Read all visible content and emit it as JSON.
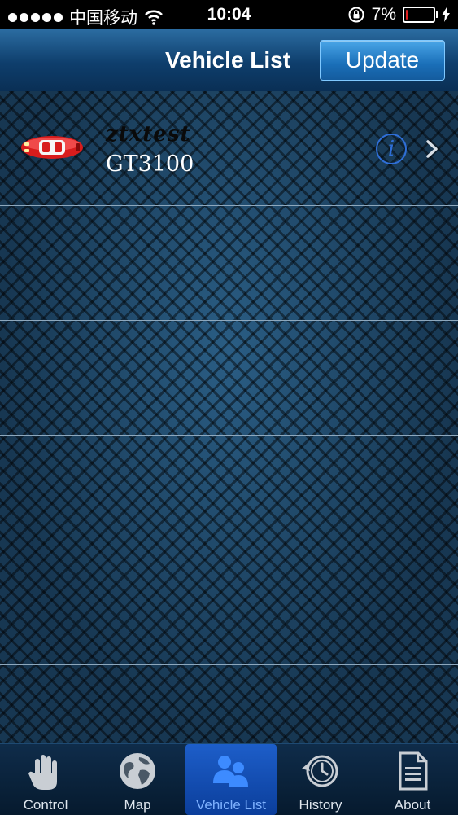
{
  "status_bar": {
    "carrier": "中国移动",
    "time": "10:04",
    "battery_percent_text": "7%",
    "battery_level": 0.07
  },
  "nav": {
    "title": "Vehicle List",
    "update_label": "Update"
  },
  "vehicles": [
    {
      "name": "ztxtest",
      "model": "GT3100"
    }
  ],
  "tabs": [
    {
      "label": "Control",
      "icon": "hand-icon"
    },
    {
      "label": "Map",
      "icon": "globe-icon"
    },
    {
      "label": "Vehicle List",
      "icon": "users-icon",
      "active": true
    },
    {
      "label": "History",
      "icon": "history-icon"
    },
    {
      "label": "About",
      "icon": "document-icon"
    }
  ],
  "colors": {
    "accent": "#1d5ec9",
    "car": "#d81c1c",
    "info": "#2f6fd8"
  }
}
